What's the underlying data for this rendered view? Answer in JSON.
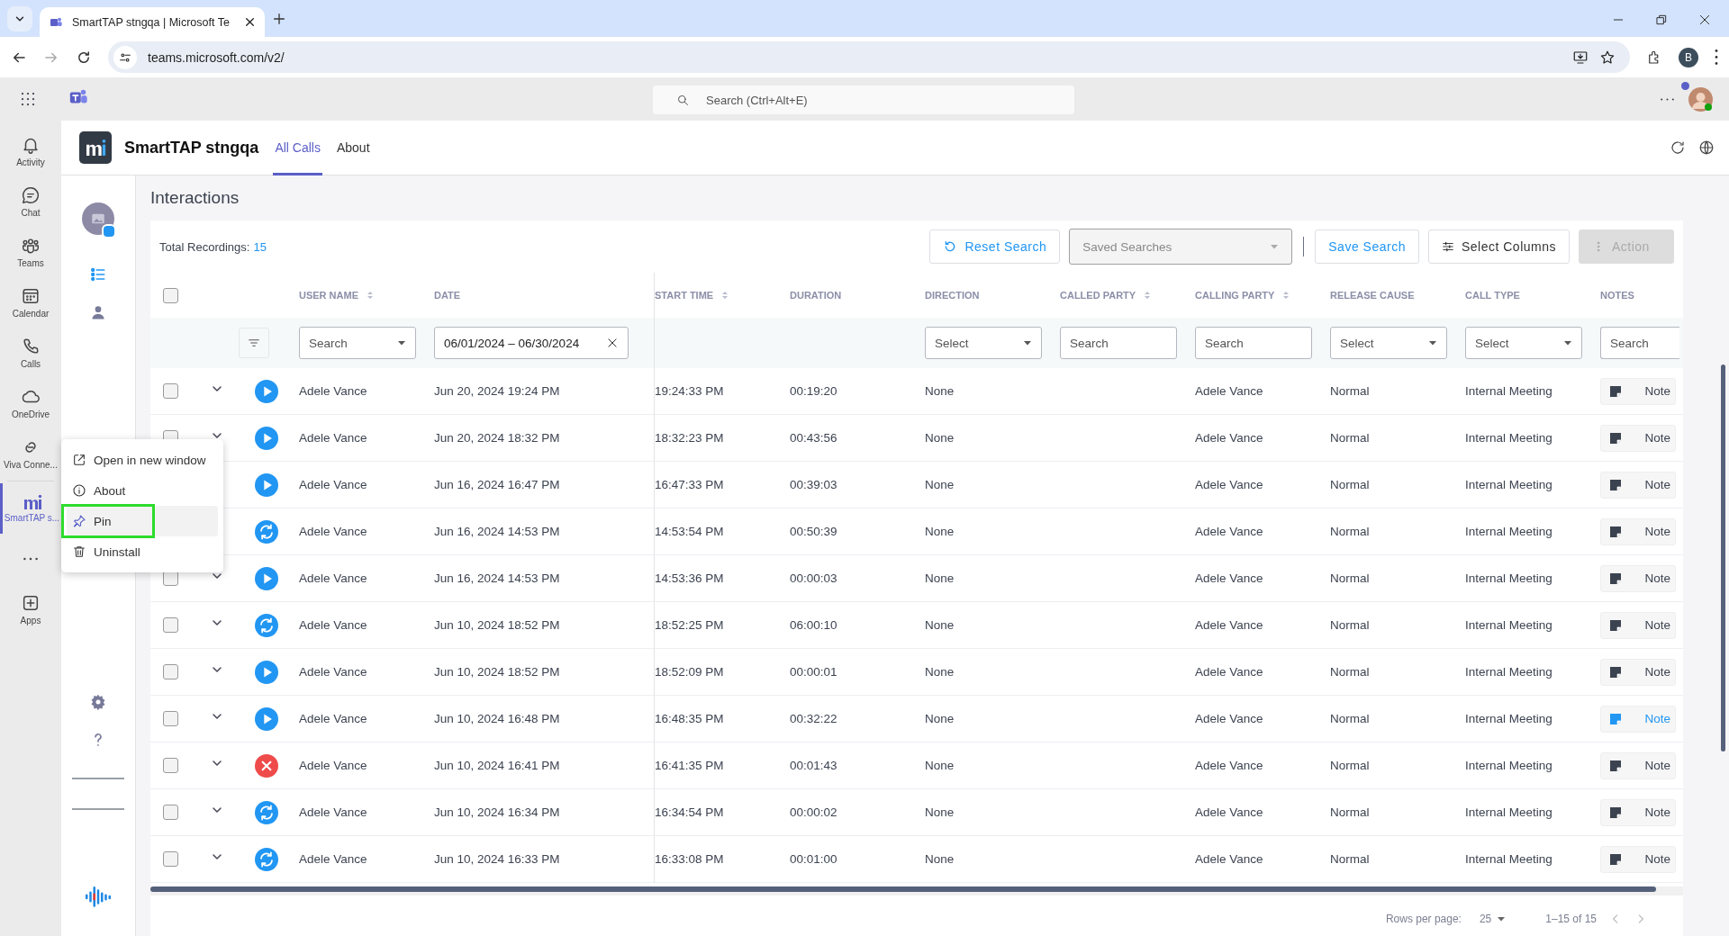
{
  "browser": {
    "tab_title": "SmartTAP stngqa | Microsoft Te",
    "url": "teams.microsoft.com/v2/",
    "profile": "B"
  },
  "teams_bar": {
    "search_placeholder": "Search (Ctrl+Alt+E)"
  },
  "rail": [
    {
      "kind": "bell",
      "label": "Activity",
      "selected": false
    },
    {
      "kind": "chat",
      "label": "Chat",
      "selected": false
    },
    {
      "kind": "teams",
      "label": "Teams",
      "selected": false
    },
    {
      "kind": "calendar",
      "label": "Calendar",
      "selected": false
    },
    {
      "kind": "calls",
      "label": "Calls",
      "selected": false
    },
    {
      "kind": "cloud",
      "label": "OneDrive",
      "selected": false
    },
    {
      "kind": "viva",
      "label": "Viva Conne...",
      "selected": false
    },
    {
      "kind": "app",
      "label": "SmartTAP s...",
      "selected": true
    },
    {
      "kind": "more"
    },
    {
      "kind": "apps",
      "label": "Apps",
      "selected": false
    }
  ],
  "context_menu": [
    {
      "kind": "open",
      "label": "Open in new window",
      "selected": false
    },
    {
      "kind": "info",
      "label": "About",
      "selected": false
    },
    {
      "kind": "pin",
      "label": "Pin",
      "selected": true
    },
    {
      "kind": "trash",
      "label": "Uninstall",
      "selected": false
    }
  ],
  "app": {
    "title": "SmartTAP stngqa",
    "tabs": [
      {
        "label": "All Calls",
        "selected": true
      },
      {
        "label": "About",
        "selected": false
      }
    ]
  },
  "side_nav": [
    {
      "kind": "list",
      "selected": true
    },
    {
      "kind": "person",
      "selected": false
    }
  ],
  "page_title": "Interactions",
  "total": {
    "label": "Total Recordings:",
    "value": "15"
  },
  "toolbar": {
    "reset": "Reset Search",
    "saved_searches": {
      "placeholder": "Saved Searches"
    },
    "save": "Save Search",
    "select_columns": "Select Columns",
    "action": {
      "label": "Action",
      "disabled": true
    }
  },
  "select_all": {
    "checked": false
  },
  "columns": [
    {
      "label": "USER NAME",
      "sortable": true
    },
    {
      "label": "DATE",
      "sortable": false
    },
    {
      "label": "START TIME",
      "sortable": true
    },
    {
      "label": "DURATION",
      "sortable": false
    },
    {
      "label": "DIRECTION",
      "sortable": false
    },
    {
      "label": "CALLED PARTY",
      "sortable": true
    },
    {
      "label": "CALLING PARTY",
      "sortable": true
    },
    {
      "label": "RELEASE CAUSE",
      "sortable": false
    },
    {
      "label": "CALL TYPE",
      "sortable": false
    },
    {
      "label": "NOTES",
      "sortable": false
    }
  ],
  "filters": [
    {
      "kind": "select",
      "placeholder": "Search"
    },
    {
      "kind": "date",
      "value": "06/01/2024 – 06/30/2024"
    },
    {
      "kind": "none"
    },
    {
      "kind": "none"
    },
    {
      "kind": "select",
      "placeholder": "Select"
    },
    {
      "kind": "input",
      "placeholder": "Search"
    },
    {
      "kind": "input",
      "placeholder": "Search"
    },
    {
      "kind": "select",
      "placeholder": "Select"
    },
    {
      "kind": "select",
      "placeholder": "Select"
    },
    {
      "kind": "input",
      "placeholder": "Search"
    }
  ],
  "rows": [
    {
      "checked": false,
      "kind": "play",
      "user": "Adele Vance",
      "date": "Jun 20, 2024 19:24 PM",
      "start": "19:24:33 PM",
      "duration": "00:19:20",
      "direction": "None",
      "calling": "Adele Vance",
      "release": "Normal",
      "call_type": "Internal Meeting",
      "note": "Note",
      "highlighted": false
    },
    {
      "checked": false,
      "kind": "play",
      "user": "Adele Vance",
      "date": "Jun 20, 2024 18:32 PM",
      "start": "18:32:23 PM",
      "duration": "00:43:56",
      "direction": "None",
      "calling": "Adele Vance",
      "release": "Normal",
      "call_type": "Internal Meeting",
      "note": "Note",
      "highlighted": false
    },
    {
      "kind": "play",
      "user": "Adele Vance",
      "date": "Jun 16, 2024 16:47 PM",
      "start": "16:47:33 PM",
      "duration": "00:39:03",
      "direction": "None",
      "calling": "Adele Vance",
      "release": "Normal",
      "call_type": "Internal Meeting",
      "note": "Note",
      "highlighted": false
    },
    {
      "kind": "sync",
      "user": "Adele Vance",
      "date": "Jun 16, 2024 14:53 PM",
      "start": "14:53:54 PM",
      "duration": "00:50:39",
      "direction": "None",
      "calling": "Adele Vance",
      "release": "Normal",
      "call_type": "Internal Meeting",
      "note": "Note",
      "highlighted": false
    },
    {
      "checked": false,
      "kind": "play",
      "user": "Adele Vance",
      "date": "Jun 16, 2024 14:53 PM",
      "start": "14:53:36 PM",
      "duration": "00:00:03",
      "direction": "None",
      "calling": "Adele Vance",
      "release": "Normal",
      "call_type": "Internal Meeting",
      "note": "Note",
      "highlighted": false
    },
    {
      "checked": false,
      "kind": "sync",
      "user": "Adele Vance",
      "date": "Jun 10, 2024 18:52 PM",
      "start": "18:52:25 PM",
      "duration": "06:00:10",
      "direction": "None",
      "calling": "Adele Vance",
      "release": "Normal",
      "call_type": "Internal Meeting",
      "note": "Note",
      "highlighted": false
    },
    {
      "checked": false,
      "kind": "play",
      "user": "Adele Vance",
      "date": "Jun 10, 2024 18:52 PM",
      "start": "18:52:09 PM",
      "duration": "00:00:01",
      "direction": "None",
      "calling": "Adele Vance",
      "release": "Normal",
      "call_type": "Internal Meeting",
      "note": "Note",
      "highlighted": false
    },
    {
      "checked": false,
      "kind": "play",
      "user": "Adele Vance",
      "date": "Jun 10, 2024 16:48 PM",
      "start": "16:48:35 PM",
      "duration": "00:32:22",
      "direction": "None",
      "calling": "Adele Vance",
      "release": "Normal",
      "call_type": "Internal Meeting",
      "note": "Note",
      "highlighted": true
    },
    {
      "checked": false,
      "kind": "error",
      "user": "Adele Vance",
      "date": "Jun 10, 2024 16:41 PM",
      "start": "16:41:35 PM",
      "duration": "00:01:43",
      "direction": "None",
      "calling": "Adele Vance",
      "release": "Normal",
      "call_type": "Internal Meeting",
      "note": "Note",
      "highlighted": false
    },
    {
      "checked": false,
      "kind": "sync",
      "user": "Adele Vance",
      "date": "Jun 10, 2024 16:34 PM",
      "start": "16:34:54 PM",
      "duration": "00:00:02",
      "direction": "None",
      "calling": "Adele Vance",
      "release": "Normal",
      "call_type": "Internal Meeting",
      "note": "Note",
      "highlighted": false
    },
    {
      "checked": false,
      "kind": "sync",
      "user": "Adele Vance",
      "date": "Jun 10, 2024 16:33 PM",
      "start": "16:33:08 PM",
      "duration": "00:01:00",
      "direction": "None",
      "calling": "Adele Vance",
      "release": "Normal",
      "call_type": "Internal Meeting",
      "note": "Note",
      "highlighted": false
    }
  ],
  "pagination": {
    "rows_per_page_label": "Rows per page:",
    "rows_per_page": "25",
    "range": "1–15 of 15"
  }
}
